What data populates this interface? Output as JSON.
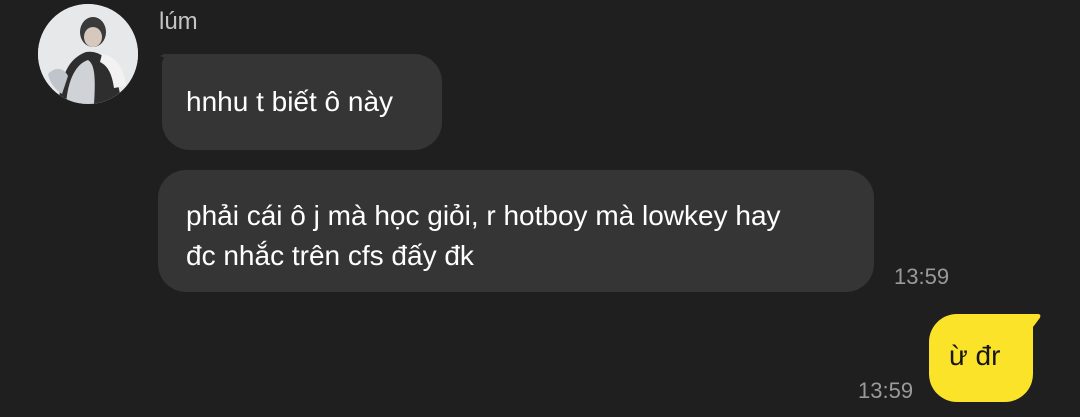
{
  "conversation": {
    "sender": {
      "name": "lúm",
      "avatar": "profile-photo"
    },
    "messages": [
      {
        "direction": "incoming",
        "text": "hnhu t biết ô này"
      },
      {
        "direction": "incoming",
        "text": "phải cái ô j mà học giỏi, r hotboy mà lowkey hay\nđc nhắc trên cfs đấy đk",
        "time": "13:59"
      },
      {
        "direction": "outgoing",
        "text": "ừ đr",
        "time": "13:59"
      }
    ]
  },
  "colors": {
    "background": "#1f1f1f",
    "incoming_bubble": "#353535",
    "outgoing_bubble": "#fbe32a",
    "timestamp": "#9a9a9a"
  }
}
